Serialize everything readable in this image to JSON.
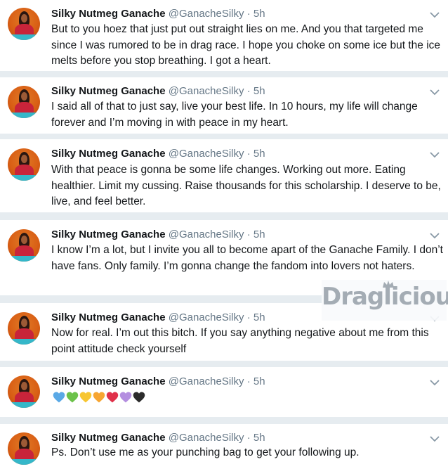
{
  "colors": {
    "background": "#e6ecf0",
    "card": "#ffffff",
    "muted": "#657786",
    "text": "#14171a"
  },
  "watermark": "Draglicious",
  "tweets": [
    {
      "name": "Silky Nutmeg Ganache",
      "handle": "@GanacheSilky",
      "sep": "·",
      "time": "5h",
      "text": "But to you hoez that just put out straight lies on me. And you that targeted me since I was rumored to be in drag race. I hope you choke on some ice but the ice melts before you stop breathing. I got a heart."
    },
    {
      "name": "Silky Nutmeg Ganache",
      "handle": "@GanacheSilky",
      "sep": "·",
      "time": "5h",
      "text": "I said all of that to just say, live your best life. In 10 hours, my life will change forever and I’m moving in with peace in my heart."
    },
    {
      "name": "Silky Nutmeg Ganache",
      "handle": "@GanacheSilky",
      "sep": "·",
      "time": "5h",
      "text": "With that peace is gonna be some life changes. Working out more. Eating healthier. Limit my cussing. Raise thousands for this scholarship. I deserve to be, live, and feel better."
    },
    {
      "name": "Silky Nutmeg Ganache",
      "handle": "@GanacheSilky",
      "sep": "·",
      "time": "5h",
      "text": "I know I’m a lot, but I invite you all to become apart of the Ganache Family. I don’t have fans. Only family. I’m gonna change the fandom into lovers not haters."
    },
    {
      "name": "Silky Nutmeg Ganache",
      "handle": "@GanacheSilky",
      "sep": "·",
      "time": "5h",
      "text": "Now for real. I’m out this bitch. If you say anything negative about me from this point attitude check yourself"
    },
    {
      "name": "Silky Nutmeg Ganache",
      "handle": "@GanacheSilky",
      "sep": "·",
      "time": "5h",
      "hearts": [
        "#5aa9e6",
        "#6cc24a",
        "#f7c631",
        "#f7a531",
        "#e0314a",
        "#b48ee0",
        "#2b2b2b"
      ]
    },
    {
      "name": "Silky Nutmeg Ganache",
      "handle": "@GanacheSilky",
      "sep": "·",
      "time": "5h",
      "text": "Ps. Don’t use me as your punching bag to get your following up."
    }
  ]
}
